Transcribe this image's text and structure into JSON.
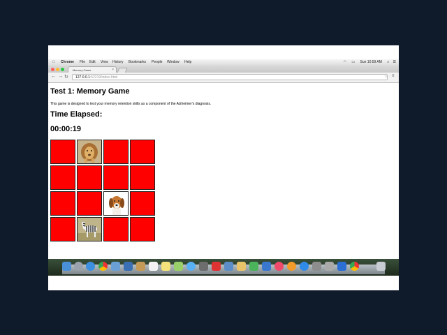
{
  "menubar": {
    "apple": "",
    "items": [
      "Chrome",
      "File",
      "Edit",
      "View",
      "History",
      "Bookmarks",
      "People",
      "Window",
      "Help"
    ],
    "clock": "Sun 10:59 AM"
  },
  "browser": {
    "tab_title": "Memory Game",
    "url_host": "127.0.0.1",
    "url_rest": ":52219/index.html"
  },
  "page": {
    "title": "Test 1: Memory Game",
    "description": "This game is designed to test your memory retention skills as a component of the Alzheimer's diagnosis.",
    "time_heading": "Time Elapsed:",
    "timer": "00:00:19"
  },
  "grid": {
    "rows": 4,
    "cols": 4,
    "cards": [
      {
        "state": "closed"
      },
      {
        "state": "open",
        "animal": "lion"
      },
      {
        "state": "closed"
      },
      {
        "state": "closed"
      },
      {
        "state": "closed"
      },
      {
        "state": "closed"
      },
      {
        "state": "closed"
      },
      {
        "state": "closed"
      },
      {
        "state": "closed"
      },
      {
        "state": "closed"
      },
      {
        "state": "open",
        "animal": "dog"
      },
      {
        "state": "closed"
      },
      {
        "state": "closed"
      },
      {
        "state": "open",
        "animal": "zebra"
      },
      {
        "state": "closed"
      },
      {
        "state": "closed"
      }
    ],
    "card_color": "#ff0000"
  },
  "dock": {
    "icons": [
      "finder-icon",
      "launchpad-icon",
      "safari-icon",
      "chrome-icon",
      "mail-icon",
      "contacts-icon",
      "calendar-icon",
      "notes-icon",
      "reminders-icon",
      "maps-icon",
      "messages-icon",
      "facetime-icon",
      "photo-booth-icon",
      "iphoto-icon",
      "pages-icon",
      "numbers-icon",
      "keynote-icon",
      "itunes-icon",
      "ibooks-icon",
      "app-store-icon",
      "preferences-icon",
      "calculator-icon",
      "screenshot-icon",
      "chrome-icon",
      "trash-icon"
    ]
  }
}
